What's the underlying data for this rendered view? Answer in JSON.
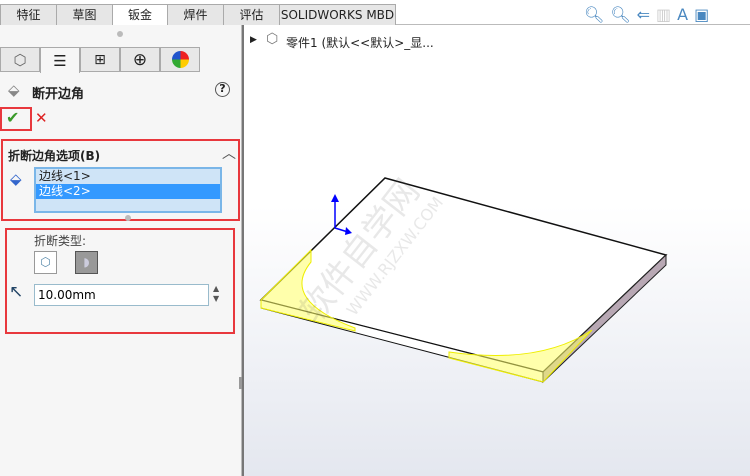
{
  "tabs": [
    "特征",
    "草图",
    "钣金",
    "焊件",
    "评估",
    "SOLIDWORKS MBD"
  ],
  "active_tab": "钣金",
  "panel": {
    "title": "断开边角",
    "help": "?",
    "section_title": "折断边角选项(B)",
    "edges": [
      "边线<1>",
      "边线<2>"
    ],
    "break_type_label": "折断类型:",
    "distance_value": "10.00mm"
  },
  "tree": {
    "item": "零件1 (默认<<默认>_显..."
  },
  "watermark": {
    "cn": "软件自学网",
    "url": "WWW.RJZXW.COM"
  },
  "colors": {
    "accent": "#3399ff",
    "highlight_box": "#e8383d",
    "selection": "#ffff55"
  }
}
